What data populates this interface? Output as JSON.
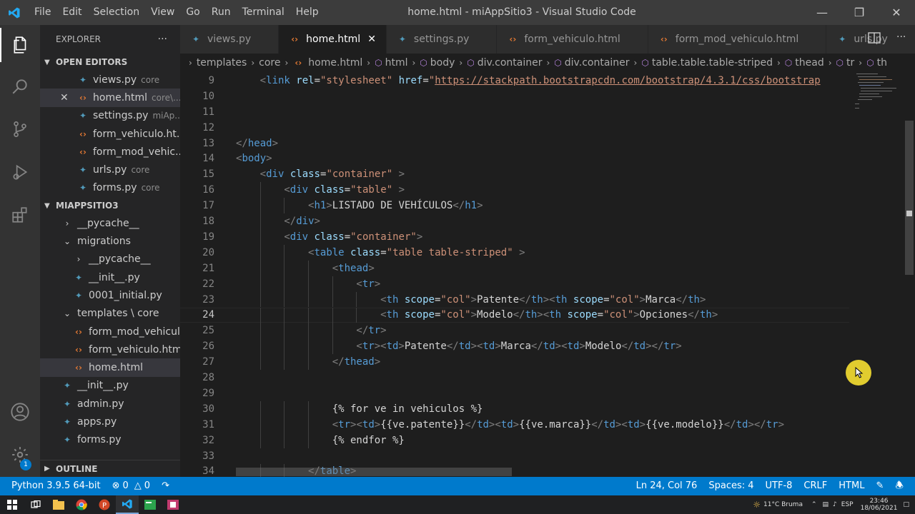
{
  "window": {
    "title": "home.html - miAppSitio3 - Visual Studio Code",
    "menu": [
      "File",
      "Edit",
      "Selection",
      "View",
      "Go",
      "Run",
      "Terminal",
      "Help"
    ]
  },
  "explorer": {
    "header": "EXPLORER",
    "more": "···",
    "open_editors": {
      "title": "OPEN EDITORS",
      "items": [
        {
          "name": "views.py",
          "path": "core",
          "type": "py"
        },
        {
          "name": "home.html",
          "path": "core\\...",
          "type": "html"
        },
        {
          "name": "settings.py",
          "path": "miAp...",
          "type": "py"
        },
        {
          "name": "form_vehiculo.ht...",
          "path": "",
          "type": "html"
        },
        {
          "name": "form_mod_vehic...",
          "path": "",
          "type": "html"
        },
        {
          "name": "urls.py",
          "path": "core",
          "type": "py"
        },
        {
          "name": "forms.py",
          "path": "core",
          "type": "py"
        }
      ]
    },
    "workspace": {
      "title": "MIAPPSITIO3",
      "items": [
        {
          "name": "__pycache__",
          "type": "folder-closed",
          "indent": 1
        },
        {
          "name": "migrations",
          "type": "folder-open",
          "indent": 1
        },
        {
          "name": "__pycache__",
          "type": "folder-closed",
          "indent": 2
        },
        {
          "name": "__init__.py",
          "type": "py",
          "indent": 2
        },
        {
          "name": "0001_initial.py",
          "type": "py",
          "indent": 2
        },
        {
          "name": "templates \\ core",
          "type": "folder-open",
          "indent": 1
        },
        {
          "name": "form_mod_vehicul...",
          "type": "html",
          "indent": 2
        },
        {
          "name": "form_vehiculo.html",
          "type": "html",
          "indent": 2
        },
        {
          "name": "home.html",
          "type": "html",
          "indent": 2
        },
        {
          "name": "__init__.py",
          "type": "py",
          "indent": 1
        },
        {
          "name": "admin.py",
          "type": "py",
          "indent": 1
        },
        {
          "name": "apps.py",
          "type": "py",
          "indent": 1
        },
        {
          "name": "forms.py",
          "type": "py",
          "indent": 1
        }
      ]
    },
    "outline": "OUTLINE"
  },
  "activity": {
    "accounts_badge": "1"
  },
  "tabs": [
    {
      "label": "views.py",
      "type": "py"
    },
    {
      "label": "home.html",
      "type": "html"
    },
    {
      "label": "settings.py",
      "type": "py"
    },
    {
      "label": "form_vehiculo.html",
      "type": "html"
    },
    {
      "label": "form_mod_vehiculo.html",
      "type": "html"
    },
    {
      "label": "urls.py",
      "type": "py"
    }
  ],
  "breadcrumb": [
    "templates",
    "core",
    "home.html",
    "html",
    "body",
    "div.container",
    "div.container",
    "table.table.table-striped",
    "thead",
    "tr",
    "th"
  ],
  "code": [
    {
      "n": "9",
      "indent": 1,
      "tokens": [
        [
          "br",
          "<"
        ],
        [
          "tag",
          "link"
        ],
        [
          "t",
          " "
        ],
        [
          "attr",
          "rel"
        ],
        [
          "t",
          "="
        ],
        [
          "str",
          "\"stylesheet\""
        ],
        [
          "t",
          " "
        ],
        [
          "attr",
          "href"
        ],
        [
          "t",
          "="
        ],
        [
          "str",
          "\""
        ],
        [
          "link",
          "https://stackpath.bootstrapcdn.com/bootstrap/4.3.1/css/bootstrap"
        ]
      ]
    },
    {
      "n": "10",
      "indent": 0,
      "tokens": []
    },
    {
      "n": "11",
      "indent": 0,
      "tokens": []
    },
    {
      "n": "12",
      "indent": 0,
      "tokens": []
    },
    {
      "n": "13",
      "indent": 0,
      "tokens": [
        [
          "br",
          "</"
        ],
        [
          "tag",
          "head"
        ],
        [
          "br",
          ">"
        ]
      ]
    },
    {
      "n": "14",
      "indent": 0,
      "tokens": [
        [
          "br",
          "<"
        ],
        [
          "tag",
          "body"
        ],
        [
          "br",
          ">"
        ]
      ]
    },
    {
      "n": "15",
      "indent": 1,
      "tokens": [
        [
          "br",
          "<"
        ],
        [
          "tag",
          "div"
        ],
        [
          "t",
          " "
        ],
        [
          "attr",
          "class"
        ],
        [
          "t",
          "="
        ],
        [
          "str",
          "\"container\""
        ],
        [
          "t",
          " "
        ],
        [
          "br",
          ">"
        ]
      ]
    },
    {
      "n": "16",
      "indent": 2,
      "tokens": [
        [
          "br",
          "<"
        ],
        [
          "tag",
          "div"
        ],
        [
          "t",
          " "
        ],
        [
          "attr",
          "class"
        ],
        [
          "t",
          "="
        ],
        [
          "str",
          "\"table\""
        ],
        [
          "t",
          " "
        ],
        [
          "br",
          ">"
        ]
      ]
    },
    {
      "n": "17",
      "indent": 3,
      "tokens": [
        [
          "br",
          "<"
        ],
        [
          "tag",
          "h1"
        ],
        [
          "br",
          ">"
        ],
        [
          "t",
          "LISTADO DE VEHÍCULOS"
        ],
        [
          "br",
          "</"
        ],
        [
          "tag",
          "h1"
        ],
        [
          "br",
          ">"
        ]
      ]
    },
    {
      "n": "18",
      "indent": 2,
      "tokens": [
        [
          "br",
          "</"
        ],
        [
          "tag",
          "div"
        ],
        [
          "br",
          ">"
        ]
      ]
    },
    {
      "n": "19",
      "indent": 2,
      "tokens": [
        [
          "br",
          "<"
        ],
        [
          "tag",
          "div"
        ],
        [
          "t",
          " "
        ],
        [
          "attr",
          "class"
        ],
        [
          "t",
          "="
        ],
        [
          "str",
          "\"container\""
        ],
        [
          "br",
          ">"
        ]
      ]
    },
    {
      "n": "20",
      "indent": 3,
      "tokens": [
        [
          "br",
          "<"
        ],
        [
          "tag",
          "table"
        ],
        [
          "t",
          " "
        ],
        [
          "attr",
          "class"
        ],
        [
          "t",
          "="
        ],
        [
          "str",
          "\"table table-striped\""
        ],
        [
          "t",
          " "
        ],
        [
          "br",
          ">"
        ]
      ]
    },
    {
      "n": "21",
      "indent": 4,
      "tokens": [
        [
          "br",
          "<"
        ],
        [
          "tag",
          "thead"
        ],
        [
          "br",
          ">"
        ]
      ]
    },
    {
      "n": "22",
      "indent": 5,
      "tokens": [
        [
          "br",
          "<"
        ],
        [
          "tag",
          "tr"
        ],
        [
          "br",
          ">"
        ]
      ]
    },
    {
      "n": "23",
      "indent": 6,
      "tokens": [
        [
          "br",
          "<"
        ],
        [
          "tag",
          "th"
        ],
        [
          "t",
          " "
        ],
        [
          "attr",
          "scope"
        ],
        [
          "t",
          "="
        ],
        [
          "str",
          "\"col\""
        ],
        [
          "br",
          ">"
        ],
        [
          "t",
          "Patente"
        ],
        [
          "br",
          "</"
        ],
        [
          "tag",
          "th"
        ],
        [
          "br",
          ">"
        ],
        [
          "br",
          "<"
        ],
        [
          "tag",
          "th"
        ],
        [
          "t",
          " "
        ],
        [
          "attr",
          "scope"
        ],
        [
          "t",
          "="
        ],
        [
          "str",
          "\"col\""
        ],
        [
          "br",
          ">"
        ],
        [
          "t",
          "Marca"
        ],
        [
          "br",
          "</"
        ],
        [
          "tag",
          "th"
        ],
        [
          "br",
          ">"
        ]
      ]
    },
    {
      "n": "24",
      "indent": 6,
      "tokens": [
        [
          "br",
          "<"
        ],
        [
          "tag",
          "th"
        ],
        [
          "t",
          " "
        ],
        [
          "attr",
          "scope"
        ],
        [
          "t",
          "="
        ],
        [
          "str",
          "\"col\""
        ],
        [
          "br",
          ">"
        ],
        [
          "t",
          "Modelo"
        ],
        [
          "br",
          "</"
        ],
        [
          "tag",
          "th"
        ],
        [
          "br",
          ">"
        ],
        [
          "br",
          "<"
        ],
        [
          "tag",
          "th"
        ],
        [
          "t",
          " "
        ],
        [
          "attr",
          "scope"
        ],
        [
          "t",
          "="
        ],
        [
          "str",
          "\"col\""
        ],
        [
          "br",
          ">"
        ],
        [
          "t",
          "Opciones"
        ],
        [
          "br",
          "</"
        ],
        [
          "tag",
          "th"
        ],
        [
          "br",
          ">"
        ]
      ]
    },
    {
      "n": "25",
      "indent": 5,
      "tokens": [
        [
          "br",
          "</"
        ],
        [
          "tag",
          "tr"
        ],
        [
          "br",
          ">"
        ]
      ]
    },
    {
      "n": "26",
      "indent": 5,
      "tokens": [
        [
          "br",
          "<"
        ],
        [
          "tag",
          "tr"
        ],
        [
          "br",
          ">"
        ],
        [
          "br",
          "<"
        ],
        [
          "tag",
          "td"
        ],
        [
          "br",
          ">"
        ],
        [
          "t",
          "Patente"
        ],
        [
          "br",
          "</"
        ],
        [
          "tag",
          "td"
        ],
        [
          "br",
          ">"
        ],
        [
          "br",
          "<"
        ],
        [
          "tag",
          "td"
        ],
        [
          "br",
          ">"
        ],
        [
          "t",
          "Marca"
        ],
        [
          "br",
          "</"
        ],
        [
          "tag",
          "td"
        ],
        [
          "br",
          ">"
        ],
        [
          "br",
          "<"
        ],
        [
          "tag",
          "td"
        ],
        [
          "br",
          ">"
        ],
        [
          "t",
          "Modelo"
        ],
        [
          "br",
          "</"
        ],
        [
          "tag",
          "td"
        ],
        [
          "br",
          ">"
        ],
        [
          "br",
          "</"
        ],
        [
          "tag",
          "tr"
        ],
        [
          "br",
          ">"
        ]
      ]
    },
    {
      "n": "27",
      "indent": 4,
      "tokens": [
        [
          "br",
          "</"
        ],
        [
          "tag",
          "thead"
        ],
        [
          "br",
          ">"
        ]
      ]
    },
    {
      "n": "28",
      "indent": 0,
      "tokens": []
    },
    {
      "n": "29",
      "indent": 0,
      "tokens": []
    },
    {
      "n": "30",
      "indent": 4,
      "tokens": [
        [
          "t",
          "{% for ve in vehiculos %}"
        ]
      ]
    },
    {
      "n": "31",
      "indent": 4,
      "tokens": [
        [
          "br",
          "<"
        ],
        [
          "tag",
          "tr"
        ],
        [
          "br",
          ">"
        ],
        [
          "br",
          "<"
        ],
        [
          "tag",
          "td"
        ],
        [
          "br",
          ">"
        ],
        [
          "t",
          "{{ve.patente}}"
        ],
        [
          "br",
          "</"
        ],
        [
          "tag",
          "td"
        ],
        [
          "br",
          ">"
        ],
        [
          "br",
          "<"
        ],
        [
          "tag",
          "td"
        ],
        [
          "br",
          ">"
        ],
        [
          "t",
          "{{ve.marca}}"
        ],
        [
          "br",
          "</"
        ],
        [
          "tag",
          "td"
        ],
        [
          "br",
          ">"
        ],
        [
          "br",
          "<"
        ],
        [
          "tag",
          "td"
        ],
        [
          "br",
          ">"
        ],
        [
          "t",
          "{{ve.modelo}}"
        ],
        [
          "br",
          "</"
        ],
        [
          "tag",
          "td"
        ],
        [
          "br",
          ">"
        ],
        [
          "br",
          "</"
        ],
        [
          "tag",
          "tr"
        ],
        [
          "br",
          ">"
        ]
      ]
    },
    {
      "n": "32",
      "indent": 4,
      "tokens": [
        [
          "t",
          "{% endfor %}"
        ]
      ]
    },
    {
      "n": "33",
      "indent": 0,
      "tokens": []
    },
    {
      "n": "34",
      "indent": 3,
      "tokens": [
        [
          "br",
          "</"
        ],
        [
          "tag",
          "table"
        ],
        [
          "br",
          ">"
        ]
      ]
    }
  ],
  "status": {
    "python": "Python 3.9.5 64-bit",
    "errors": "0",
    "warnings": "0",
    "position": "Ln 24, Col 76",
    "spaces": "Spaces: 4",
    "encoding": "UTF-8",
    "eol": "CRLF",
    "language": "HTML"
  },
  "taskbar": {
    "weather": "11°C Bruma",
    "lang": "ESP",
    "time": "23:46",
    "date": "18/06/2021"
  }
}
